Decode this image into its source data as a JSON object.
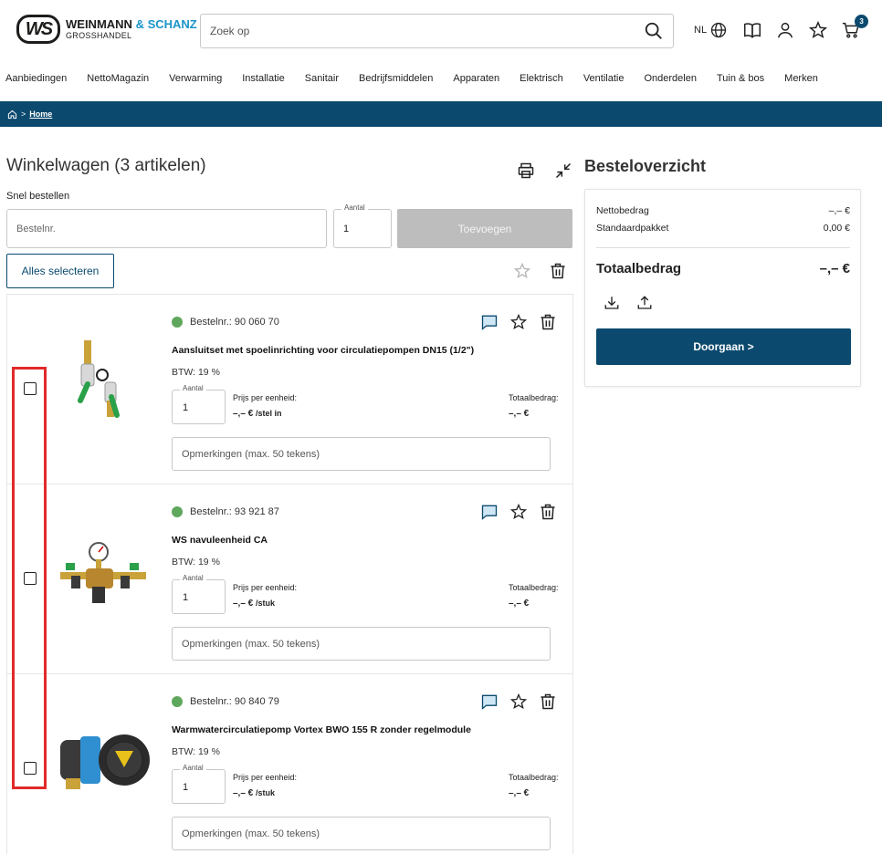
{
  "header": {
    "logo_mark": "WS",
    "logo_name": "WEINMANN",
    "logo_accent": "& SCHANZ",
    "logo_sub": "GROSSHANDEL",
    "search_placeholder": "Zoek op",
    "lang": "NL",
    "cart_count": "3"
  },
  "nav": [
    "Aanbiedingen",
    "NettoMagazin",
    "Verwarming",
    "Installatie",
    "Sanitair",
    "Bedrijfsmiddelen",
    "Apparaten",
    "Elektrisch",
    "Ventilatie",
    "Onderdelen",
    "Tuin & bos",
    "Merken"
  ],
  "breadcrumb": {
    "sep": ">",
    "home": "Home"
  },
  "cart": {
    "title": "Winkelwagen (3 artikelen)",
    "quick_order_label": "Snel bestellen",
    "order_no_placeholder": "Bestelnr.",
    "qty_label": "Aantal",
    "qty_value": "1",
    "add_label": "Toevoegen",
    "select_all_label": "Alles selecteren",
    "items": [
      {
        "order_no": "Bestelnr.: 90 060 70",
        "name": "Aansluitset met spoelinrichting voor circulatiepompen DN15 (1/2\")",
        "vat": "BTW: 19 %",
        "qty_label": "Aantal",
        "qty": "1",
        "price_label": "Prijs per eenheid:",
        "price": "–,– €",
        "unit": "/stel in",
        "total_label": "Totaalbedrag:",
        "total": "–,– €",
        "remarks_placeholder": "Opmerkingen (max. 50 tekens)"
      },
      {
        "order_no": "Bestelnr.: 93 921 87",
        "name": "WS navuleenheid CA",
        "vat": "BTW: 19 %",
        "qty_label": "Aantal",
        "qty": "1",
        "price_label": "Prijs per eenheid:",
        "price": "–,– €",
        "unit": "/stuk",
        "total_label": "Totaalbedrag:",
        "total": "–,– €",
        "remarks_placeholder": "Opmerkingen (max. 50 tekens)"
      },
      {
        "order_no": "Bestelnr.: 90 840 79",
        "name": "Warmwatercirculatiepomp Vortex BWO 155 R zonder regelmodule",
        "vat": "BTW: 19 %",
        "qty_label": "Aantal",
        "qty": "1",
        "price_label": "Prijs per eenheid:",
        "price": "–,– €",
        "unit": "/stuk",
        "total_label": "Totaalbedrag:",
        "total": "–,– €",
        "remarks_placeholder": "Opmerkingen (max. 50 tekens)"
      }
    ]
  },
  "summary": {
    "title": "Besteloverzicht",
    "net_label": "Nettobedrag",
    "net_value": "–,– €",
    "package_label": "Standaardpakket",
    "package_value": "0,00 €",
    "total_label": "Totaalbedrag",
    "total_value": "–,– €",
    "proceed_label": "Doorgaan >"
  },
  "colors": {
    "brand": "#0b4a6e",
    "accent": "#1a94c8",
    "available": "#5fa75c",
    "highlight": "#e12a2a"
  },
  "icons": [
    "search-icon",
    "globe-icon",
    "catalog-icon",
    "user-icon",
    "star-icon",
    "cart-icon",
    "home-icon",
    "print-icon",
    "collapse-icon",
    "trash-icon",
    "comment-icon",
    "download-icon",
    "upload-icon"
  ]
}
